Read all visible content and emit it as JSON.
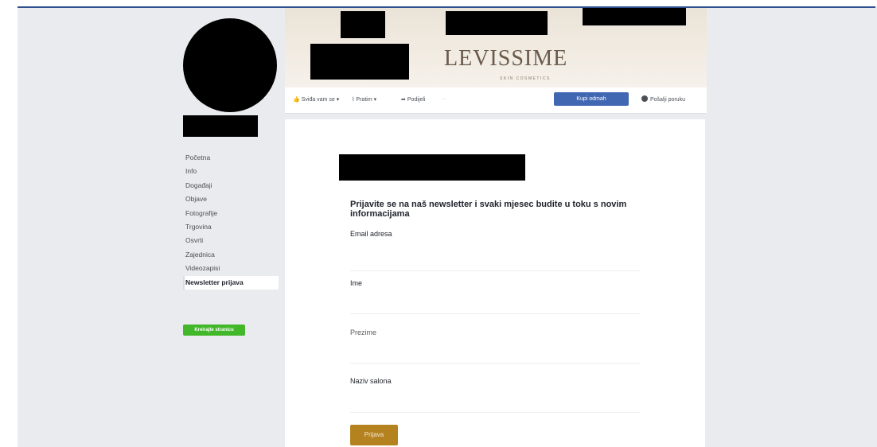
{
  "cover": {
    "brand": "LEVISSIME",
    "brand_sub": "SKIN COSMETICS"
  },
  "actions": {
    "like_label": "Sviđa vam se",
    "follow_label": "Pratim",
    "share_label": "Podijeli",
    "more_label": "···",
    "shop_label": "Kupi odmah",
    "message_label": "Pošalji poruku"
  },
  "sidebar": {
    "items": [
      {
        "label": "Početna"
      },
      {
        "label": "Info"
      },
      {
        "label": "Događaji"
      },
      {
        "label": "Objave"
      },
      {
        "label": "Fotografije"
      },
      {
        "label": "Trgovina"
      },
      {
        "label": "Osvrti"
      },
      {
        "label": "Zajednica"
      },
      {
        "label": "Videozapisi"
      },
      {
        "label": "Newsletter prijava"
      }
    ],
    "create_label": "Kreirajte stranicu"
  },
  "form": {
    "intro": "Prijavite se na naš newsletter i svaki mjesec budite u toku s novim informacijama",
    "fields": [
      {
        "label": "Email adresa"
      },
      {
        "label": "Ime"
      },
      {
        "label": "Prezime"
      },
      {
        "label": "Naziv salona"
      }
    ],
    "submit_label": "Prijava"
  },
  "colors": {
    "accent": "#4267b2",
    "submit": "#b4821f",
    "create": "#42b72a"
  }
}
